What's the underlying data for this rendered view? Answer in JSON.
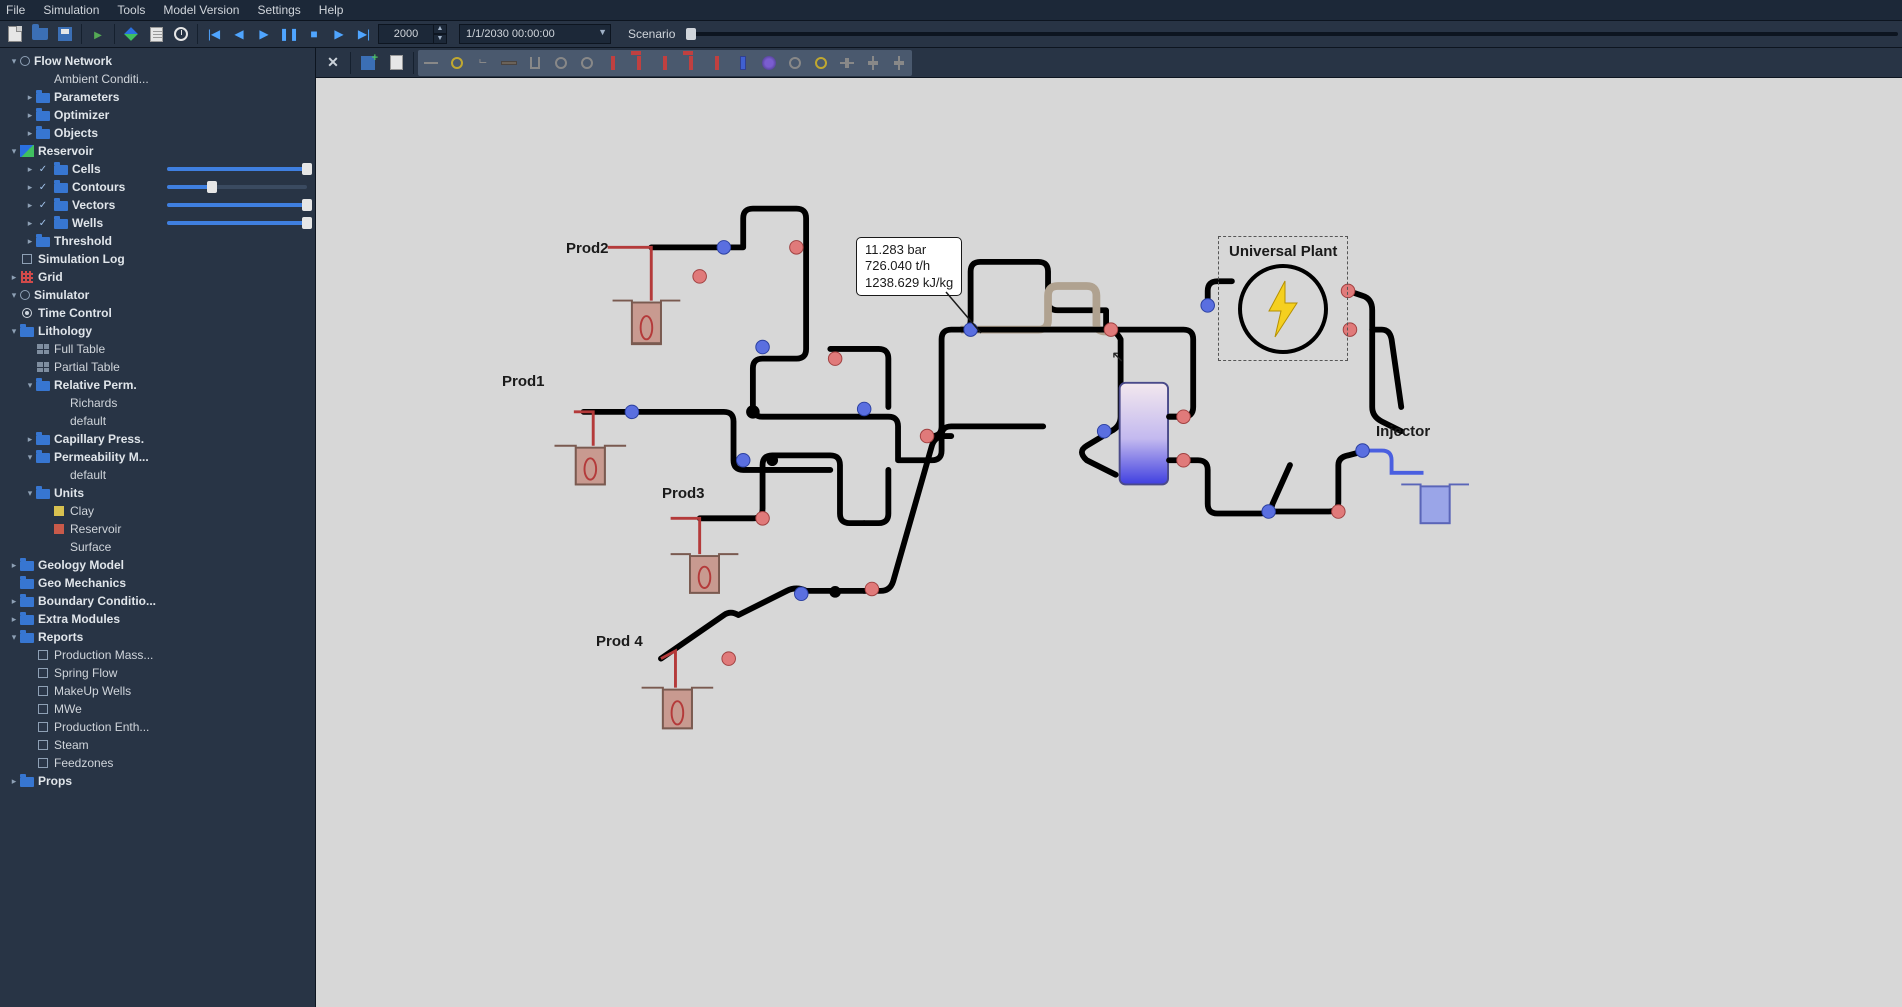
{
  "menu": {
    "items": [
      "File",
      "Simulation",
      "Tools",
      "Model Version",
      "Settings",
      "Help"
    ]
  },
  "toolbar": {
    "year": "2000",
    "date": "1/1/2030 00:00:00",
    "scenario_label": "Scenario"
  },
  "tree": [
    {
      "d": 0,
      "c": "down",
      "ic": "dot",
      "b": 1,
      "t": "Flow Network"
    },
    {
      "d": 1,
      "c": "",
      "ic": "",
      "b": 0,
      "t": "Ambient Conditi..."
    },
    {
      "d": 1,
      "c": "right",
      "ic": "folder",
      "b": 1,
      "t": "Parameters"
    },
    {
      "d": 1,
      "c": "right",
      "ic": "folder",
      "b": 1,
      "t": "Optimizer"
    },
    {
      "d": 1,
      "c": "right",
      "ic": "folder",
      "b": 1,
      "t": "Objects"
    },
    {
      "d": 0,
      "c": "down",
      "ic": "res",
      "b": 1,
      "t": "Reservoir"
    },
    {
      "d": 1,
      "c": "right",
      "ic": "folder",
      "b": 1,
      "t": "Cells",
      "chk": 1,
      "slider": 100
    },
    {
      "d": 1,
      "c": "right",
      "ic": "folder",
      "b": 1,
      "t": "Contours",
      "chk": 1,
      "slider": 32
    },
    {
      "d": 1,
      "c": "right",
      "ic": "folder",
      "b": 1,
      "t": "Vectors",
      "chk": 1,
      "slider": 100
    },
    {
      "d": 1,
      "c": "right",
      "ic": "folder",
      "b": 1,
      "t": "Wells",
      "chk": 1,
      "slider": 100
    },
    {
      "d": 1,
      "c": "right",
      "ic": "folder",
      "b": 1,
      "t": "Threshold"
    },
    {
      "d": 0,
      "c": "",
      "ic": "box",
      "b": 1,
      "t": "Simulation Log"
    },
    {
      "d": 0,
      "c": "right",
      "ic": "gridred",
      "b": 1,
      "t": "Grid"
    },
    {
      "d": 0,
      "c": "down",
      "ic": "dot",
      "b": 1,
      "t": "Simulator"
    },
    {
      "d": 0,
      "c": "",
      "ic": "radioon",
      "b": 1,
      "t": "Time Control"
    },
    {
      "d": 0,
      "c": "down",
      "ic": "folder",
      "b": 1,
      "t": "Lithology"
    },
    {
      "d": 1,
      "c": "",
      "ic": "table",
      "b": 0,
      "t": "Full Table"
    },
    {
      "d": 1,
      "c": "",
      "ic": "table",
      "b": 0,
      "t": "Partial Table"
    },
    {
      "d": 1,
      "c": "down",
      "ic": "folder",
      "b": 1,
      "t": "Relative Perm."
    },
    {
      "d": 2,
      "c": "",
      "ic": "",
      "b": 0,
      "t": "Richards"
    },
    {
      "d": 2,
      "c": "",
      "ic": "",
      "b": 0,
      "t": "default"
    },
    {
      "d": 1,
      "c": "right",
      "ic": "folder",
      "b": 1,
      "t": "Capillary Press."
    },
    {
      "d": 1,
      "c": "down",
      "ic": "folder",
      "b": 1,
      "t": "Permeability M..."
    },
    {
      "d": 2,
      "c": "",
      "ic": "",
      "b": 0,
      "t": "default"
    },
    {
      "d": 1,
      "c": "down",
      "ic": "folder",
      "b": 1,
      "t": "Units"
    },
    {
      "d": 2,
      "c": "",
      "ic": "sqyellow",
      "b": 0,
      "t": "Clay"
    },
    {
      "d": 2,
      "c": "",
      "ic": "sqred",
      "b": 0,
      "t": "Reservoir"
    },
    {
      "d": 2,
      "c": "",
      "ic": "",
      "b": 0,
      "t": "Surface"
    },
    {
      "d": 0,
      "c": "right",
      "ic": "folder",
      "b": 1,
      "t": "Geology Model"
    },
    {
      "d": 0,
      "c": "",
      "ic": "folder",
      "b": 1,
      "t": "Geo Mechanics"
    },
    {
      "d": 0,
      "c": "right",
      "ic": "folder",
      "b": 1,
      "t": "Boundary Conditio..."
    },
    {
      "d": 0,
      "c": "right",
      "ic": "folder",
      "b": 1,
      "t": "Extra Modules"
    },
    {
      "d": 0,
      "c": "down",
      "ic": "folder",
      "b": 1,
      "t": "Reports"
    },
    {
      "d": 1,
      "c": "",
      "ic": "box",
      "b": 0,
      "t": "Production Mass..."
    },
    {
      "d": 1,
      "c": "",
      "ic": "box",
      "b": 0,
      "t": "Spring Flow"
    },
    {
      "d": 1,
      "c": "",
      "ic": "box",
      "b": 0,
      "t": "MakeUp Wells"
    },
    {
      "d": 1,
      "c": "",
      "ic": "box",
      "b": 0,
      "t": "MWe"
    },
    {
      "d": 1,
      "c": "",
      "ic": "box",
      "b": 0,
      "t": "Production Enth..."
    },
    {
      "d": 1,
      "c": "",
      "ic": "box",
      "b": 0,
      "t": "Steam"
    },
    {
      "d": 1,
      "c": "",
      "ic": "box",
      "b": 0,
      "t": "Feedzones"
    },
    {
      "d": 0,
      "c": "right",
      "ic": "folder",
      "b": 1,
      "t": "Props"
    }
  ],
  "canvas": {
    "labels": {
      "prod1": "Prod1",
      "prod2": "Prod2",
      "prod3": "Prod3",
      "prod4": "Prod 4",
      "injector": "Injector",
      "plant": "Universal Plant"
    },
    "tooltip": {
      "line1": "11.283 bar",
      "line2": "726.040 t/h",
      "line3": "1238.629 kJ/kg"
    }
  }
}
